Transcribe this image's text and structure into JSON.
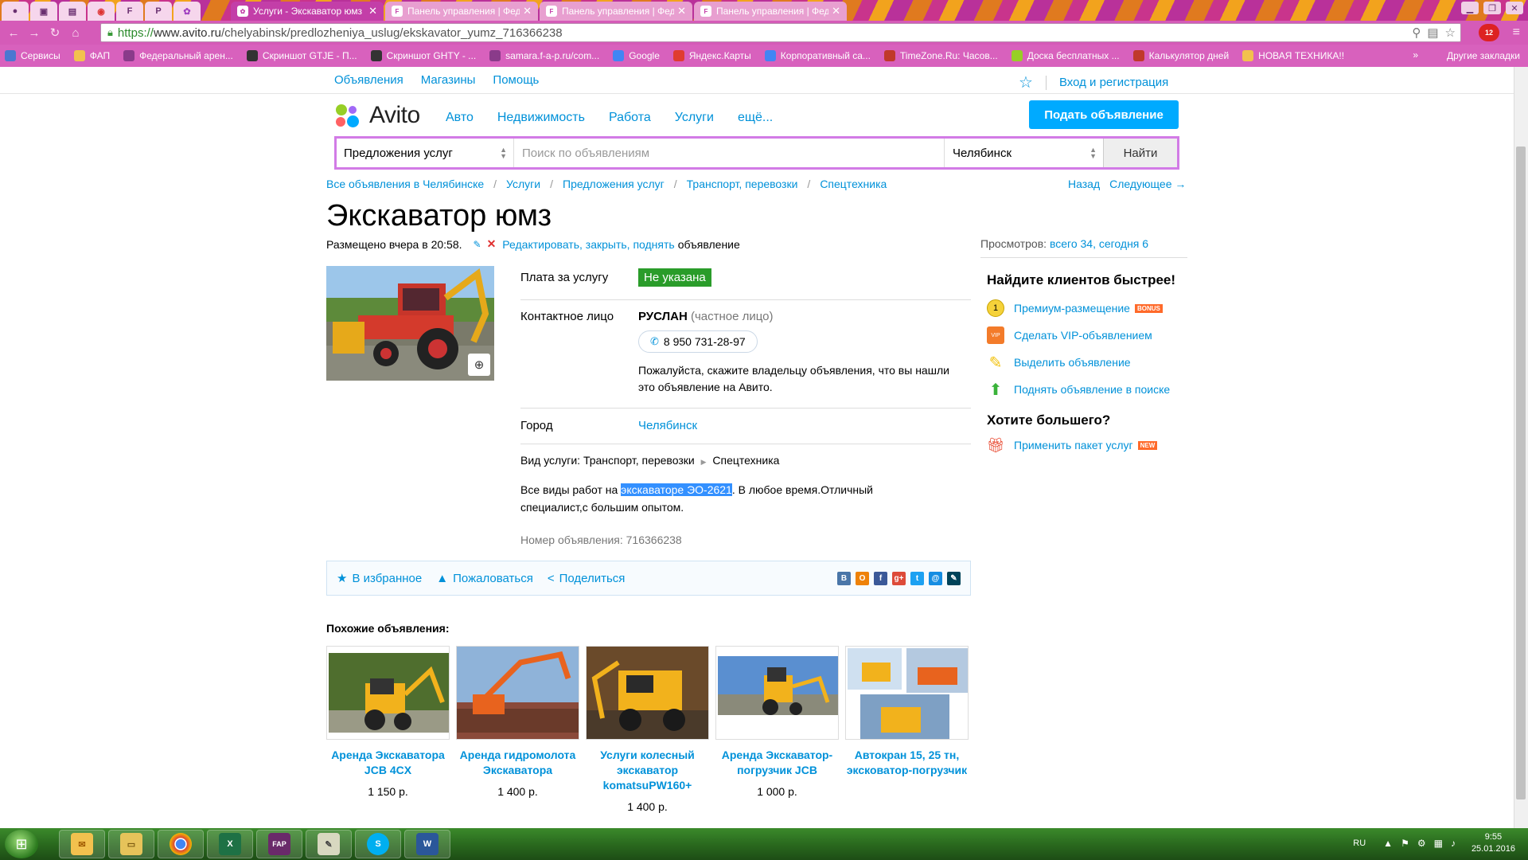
{
  "browser": {
    "tabs": [
      {
        "title": "Услуги - Экскаватор юмз",
        "active": true
      },
      {
        "title": "Панель управления | Фед",
        "active": false
      },
      {
        "title": "Панель управления | Фед",
        "active": false
      },
      {
        "title": "Панель управления | Фед",
        "active": false
      }
    ],
    "url_scheme": "https://",
    "url_host": "www.avito.ru",
    "url_path": "/chelyabinsk/predlozheniya_uslug/ekskavator_yumz_716366238",
    "ext_badge": "12",
    "bookmarks": [
      {
        "label": "Сервисы",
        "color": "#4b77d1"
      },
      {
        "label": "ФАП",
        "color": "#f2c14e"
      },
      {
        "label": "Федеральный арен...",
        "color": "#8a3b8a"
      },
      {
        "label": "Скриншот GTJE - П...",
        "color": "#333333"
      },
      {
        "label": "Скриншот GHTY - ...",
        "color": "#333333"
      },
      {
        "label": "samara.f-a-p.ru/com...",
        "color": "#8a3b8a"
      },
      {
        "label": "Google",
        "color": "#4285f4"
      },
      {
        "label": "Яндекс.Карты",
        "color": "#e03c31"
      },
      {
        "label": "Корпоративный са...",
        "color": "#4285f4"
      },
      {
        "label": "TimeZone.Ru: Часов...",
        "color": "#c0392b"
      },
      {
        "label": "Доска бесплатных ...",
        "color": "#97cf26"
      },
      {
        "label": "Калькулятор дней",
        "color": "#c0392b"
      },
      {
        "label": "НОВАЯ ТЕХНИКА!!",
        "color": "#f2c14e"
      }
    ],
    "bookmarks_more": "»",
    "other_bookmarks": "Другие закладки"
  },
  "site": {
    "topnav": [
      "Объявления",
      "Магазины",
      "Помощь"
    ],
    "login": "Вход и регистрация",
    "logo": "Avito",
    "categories": [
      "Авто",
      "Недвижимость",
      "Работа",
      "Услуги",
      "ещё..."
    ],
    "post_button": "Подать объявление",
    "search": {
      "category": "Предложения услуг",
      "placeholder": "Поиск по объявлениям",
      "city": "Челябинск",
      "button": "Найти"
    },
    "breadcrumbs": [
      "Все объявления в Челябинске",
      "Услуги",
      "Предложения услуг",
      "Транспорт, перевозки",
      "Спецтехника"
    ],
    "breadcrumb_sep": "/",
    "pager": {
      "back": "Назад",
      "next": "Следующее →"
    }
  },
  "ad": {
    "title": "Экскаватор юмз",
    "posted": "Размещено вчера в 20:58.",
    "edit_link": "Редактировать, закрыть, поднять",
    "edit_rest": "объявление",
    "views_label": "Просмотров:",
    "views_value": "всего 34, сегодня 6",
    "price_label": "Плата за услугу",
    "price_value": "Не указана",
    "contact_label": "Контактное лицо",
    "contact_name": "РУСЛАН",
    "contact_type": "(частное лицо)",
    "phone": "8 950 731-28-97",
    "phone_note": "Пожалуйста, скажите владельцу объявления, что вы нашли это объявление на Авито.",
    "city_label": "Город",
    "city_value": "Челябинск",
    "service_label": "Вид услуги:",
    "service_value": "Транспорт, перевозки",
    "service_sub": "Спецтехника",
    "desc_before": "Все виды работ на ",
    "desc_highlight": "экскаваторе ЭО-2621",
    "desc_after": ". В любое время.Отличный специалист,с большим опытом.",
    "number_label": "Номер объявления:",
    "number_value": "716366238",
    "actions": {
      "favorite": "В избранное",
      "complain": "Пожаловаться",
      "share": "Поделиться"
    },
    "share_icons": [
      {
        "name": "vk",
        "glyph": "B",
        "color": "#4a76a8"
      },
      {
        "name": "ok",
        "glyph": "O",
        "color": "#ee8208"
      },
      {
        "name": "fb",
        "glyph": "f",
        "color": "#3b5998"
      },
      {
        "name": "gplus",
        "glyph": "g+",
        "color": "#dd4b39"
      },
      {
        "name": "twitter",
        "glyph": "t",
        "color": "#1da1f2"
      },
      {
        "name": "mail",
        "glyph": "@",
        "color": "#168de2"
      },
      {
        "name": "livejournal",
        "glyph": "✎",
        "color": "#004359"
      }
    ]
  },
  "promo": {
    "heading": "Найдите клиентов быстрее!",
    "items": [
      {
        "label": "Премиум-размещение",
        "tag": "BONUS",
        "icon": "coin-icon"
      },
      {
        "label": "Сделать VIP-объявлением",
        "tag": "",
        "icon": "vip-icon"
      },
      {
        "label": "Выделить объявление",
        "tag": "",
        "icon": "highlighter-icon"
      },
      {
        "label": "Поднять объявление в поиске",
        "tag": "",
        "icon": "arrow-up-icon"
      }
    ],
    "heading2": "Хотите большего?",
    "package": {
      "label": "Применить пакет услуг",
      "tag": "NEW"
    }
  },
  "similar": {
    "heading": "Похожие объявления:",
    "items": [
      {
        "title": "Аренда Экскаватора JCB 4CX",
        "price": "1 150 р."
      },
      {
        "title": "Аренда гидромолота Экскаватора",
        "price": "1 400 р."
      },
      {
        "title": "Услуги колесный экскаватор komatsuPW160+",
        "price": "1 400 р."
      },
      {
        "title": "Аренда Экскаватор-погрузчик JCB",
        "price": "1 000 р."
      },
      {
        "title": "Автокран 15, 25 тн, эксковатор-погрузчик",
        "price": ""
      }
    ]
  },
  "taskbar": {
    "lang": "RU",
    "time": "9:55",
    "date": "25.01.2016",
    "apps": [
      "outlook",
      "explorer",
      "chrome",
      "excel",
      "fap",
      "notes",
      "skype",
      "word"
    ]
  }
}
